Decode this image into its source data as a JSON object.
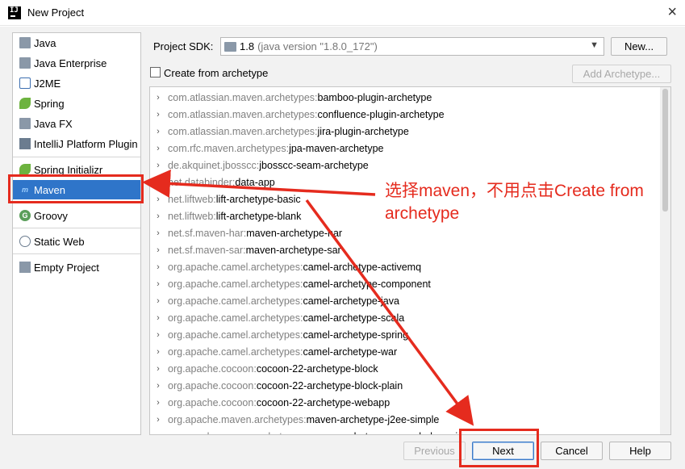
{
  "window": {
    "title": "New Project"
  },
  "left_panel": {
    "items": [
      {
        "label": "Java",
        "icon": "folder-icon"
      },
      {
        "label": "Java Enterprise",
        "icon": "folder-icon"
      },
      {
        "label": "J2ME",
        "icon": "j2me-icon"
      },
      {
        "label": "Spring",
        "icon": "spring-icon"
      },
      {
        "label": "Java FX",
        "icon": "folder-icon"
      },
      {
        "label": "IntelliJ Platform Plugin",
        "icon": "intellij-plugin-icon"
      },
      {
        "label": "Spring Initializr",
        "icon": "spring-icon"
      },
      {
        "label": "Maven",
        "icon": "maven-icon",
        "selected": true
      },
      {
        "label": "Groovy",
        "icon": "groovy-icon"
      },
      {
        "label": "Static Web",
        "icon": "web-icon"
      },
      {
        "label": "Empty Project",
        "icon": "folder-icon"
      }
    ]
  },
  "sdk": {
    "label": "Project SDK:",
    "value": "1.8",
    "detail": "(java version \"1.8.0_172\")",
    "new_button": "New..."
  },
  "archetype": {
    "create_from_label": "Create from archetype",
    "checked": false,
    "add_button": "Add Archetype..."
  },
  "archetypes": [
    {
      "group": "com.atlassian.maven.archetypes:",
      "artifact": "bamboo-plugin-archetype"
    },
    {
      "group": "com.atlassian.maven.archetypes:",
      "artifact": "confluence-plugin-archetype"
    },
    {
      "group": "com.atlassian.maven.archetypes:",
      "artifact": "jira-plugin-archetype"
    },
    {
      "group": "com.rfc.maven.archetypes:",
      "artifact": "jpa-maven-archetype"
    },
    {
      "group": "de.akquinet.jbosscc:",
      "artifact": "jbosscc-seam-archetype"
    },
    {
      "group": "net.databinder:",
      "artifact": "data-app"
    },
    {
      "group": "net.liftweb:",
      "artifact": "lift-archetype-basic"
    },
    {
      "group": "net.liftweb:",
      "artifact": "lift-archetype-blank"
    },
    {
      "group": "net.sf.maven-har:",
      "artifact": "maven-archetype-har"
    },
    {
      "group": "net.sf.maven-sar:",
      "artifact": "maven-archetype-sar"
    },
    {
      "group": "org.apache.camel.archetypes:",
      "artifact": "camel-archetype-activemq"
    },
    {
      "group": "org.apache.camel.archetypes:",
      "artifact": "camel-archetype-component"
    },
    {
      "group": "org.apache.camel.archetypes:",
      "artifact": "camel-archetype-java"
    },
    {
      "group": "org.apache.camel.archetypes:",
      "artifact": "camel-archetype-scala"
    },
    {
      "group": "org.apache.camel.archetypes:",
      "artifact": "camel-archetype-spring"
    },
    {
      "group": "org.apache.camel.archetypes:",
      "artifact": "camel-archetype-war"
    },
    {
      "group": "org.apache.cocoon:",
      "artifact": "cocoon-22-archetype-block"
    },
    {
      "group": "org.apache.cocoon:",
      "artifact": "cocoon-22-archetype-block-plain"
    },
    {
      "group": "org.apache.cocoon:",
      "artifact": "cocoon-22-archetype-webapp"
    },
    {
      "group": "org.apache.maven.archetypes:",
      "artifact": "maven-archetype-j2ee-simple"
    },
    {
      "group": "org.apache.maven.archetypes:",
      "artifact": "maven-archetype-marmalade-mojo"
    }
  ],
  "footer": {
    "previous": "Previous",
    "next": "Next",
    "cancel": "Cancel",
    "help": "Help"
  },
  "annotation": {
    "text": "选择maven，不用点击Create from archetype",
    "color": "#e52b1e"
  },
  "colors": {
    "selection": "#2f75c9",
    "annotation_red": "#e52b1e"
  }
}
